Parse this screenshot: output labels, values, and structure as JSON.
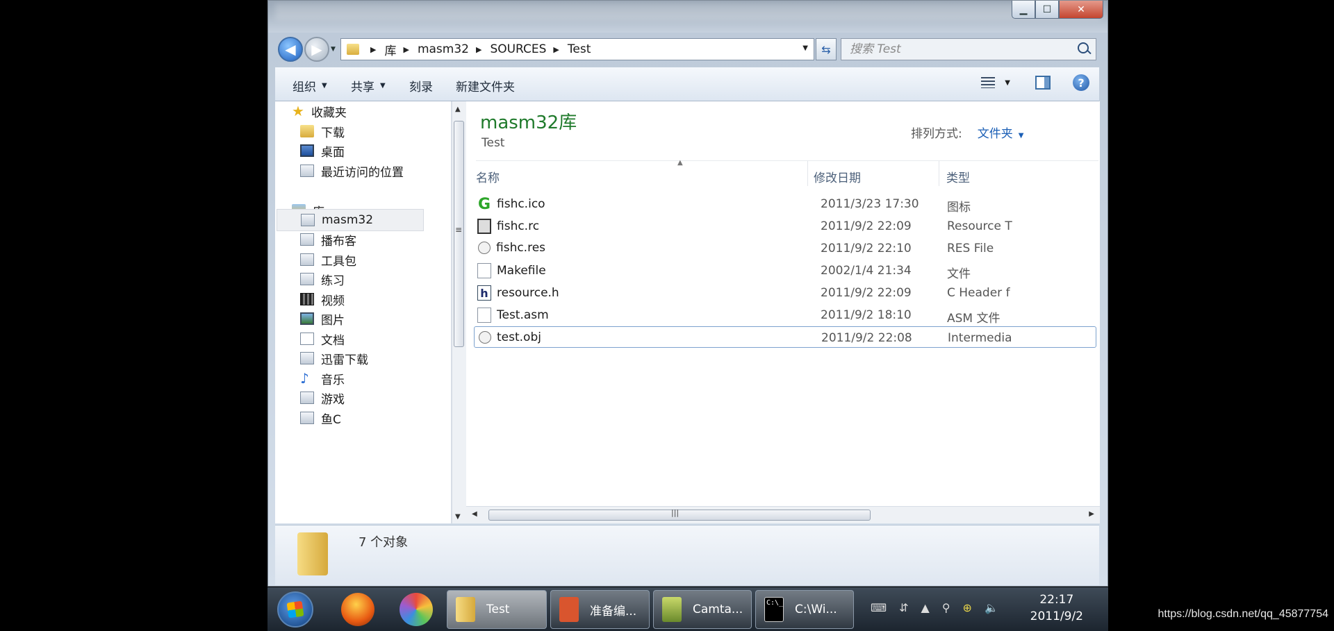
{
  "window": {
    "minimize_glyph": "▁",
    "maximize_glyph": "☐",
    "close_glyph": "✕"
  },
  "address": {
    "crumbs": [
      "库",
      "masm32",
      "SOURCES",
      "Test"
    ]
  },
  "search": {
    "placeholder": "搜索 Test"
  },
  "toolbar": {
    "organize": "组织",
    "share": "共享",
    "burn": "刻录",
    "new_folder": "新建文件夹",
    "help": "?"
  },
  "nav": {
    "favorites": "收藏夹",
    "downloads": "下载",
    "desktop": "桌面",
    "recent": "最近访问的位置",
    "libraries": "库",
    "items": [
      "masm32",
      "播布客",
      "工具包",
      "练习",
      "视频",
      "图片",
      "文档",
      "迅雷下载",
      "音乐",
      "游戏",
      "鱼C"
    ]
  },
  "content": {
    "library_title": "masm32库",
    "library_subtitle": "Test",
    "sort_label": "排列方式:",
    "sort_value": "文件夹",
    "columns": {
      "name": "名称",
      "date": "修改日期",
      "type": "类型"
    },
    "files": [
      {
        "name": "fishc.ico",
        "date": "2011/3/23 17:30",
        "type": "图标"
      },
      {
        "name": "fishc.rc",
        "date": "2011/9/2 22:09",
        "type": "Resource T"
      },
      {
        "name": "fishc.res",
        "date": "2011/9/2 22:10",
        "type": "RES File"
      },
      {
        "name": "Makefile",
        "date": "2002/1/4 21:34",
        "type": "文件"
      },
      {
        "name": "resource.h",
        "date": "2011/9/2 22:09",
        "type": "C Header f"
      },
      {
        "name": "Test.asm",
        "date": "2011/9/2 18:10",
        "type": "ASM 文件"
      },
      {
        "name": "test.obj",
        "date": "2011/9/2 22:08",
        "type": "Intermedia"
      }
    ]
  },
  "details": {
    "count": "7 个对象"
  },
  "taskbar": {
    "tasks": [
      "Test",
      "准备编...",
      "Camta...",
      "C:\\Wi..."
    ],
    "cmd_icon_text": "C:\\_",
    "time": "22:17",
    "date": "2011/9/2"
  },
  "watermark": "https://blog.csdn.net/qq_45877754"
}
